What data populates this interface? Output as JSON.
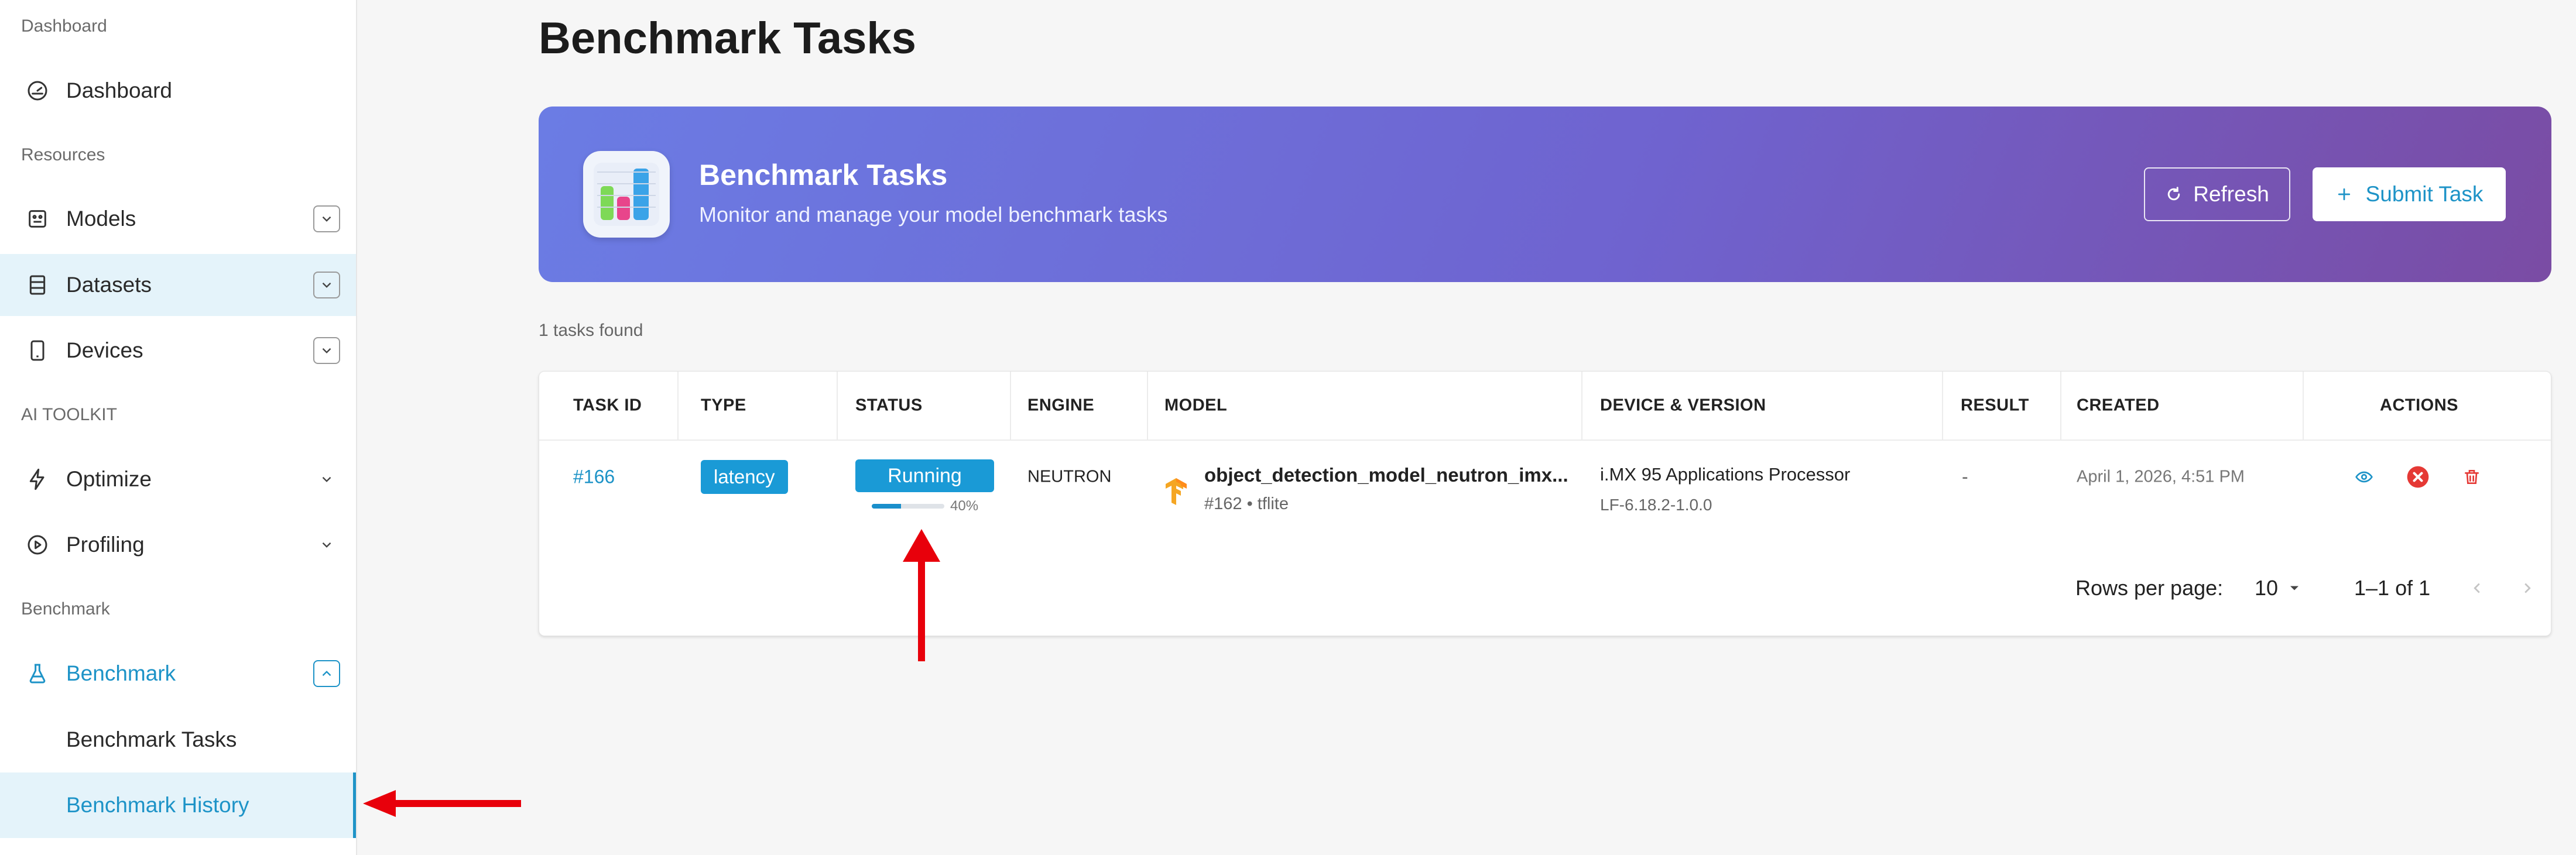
{
  "sidebar": {
    "section_dashboard": "Dashboard",
    "dashboard": "Dashboard",
    "section_resources": "Resources",
    "models": "Models",
    "datasets": "Datasets",
    "devices": "Devices",
    "section_ai_toolkit": "AI TOOLKIT",
    "optimize": "Optimize",
    "profiling": "Profiling",
    "section_benchmark": "Benchmark",
    "benchmark": "Benchmark",
    "benchmark_tasks": "Benchmark Tasks",
    "benchmark_history": "Benchmark History"
  },
  "page": {
    "title": "Benchmark Tasks"
  },
  "hero": {
    "title": "Benchmark Tasks",
    "subtitle": "Monitor and manage your model benchmark tasks",
    "refresh_label": "Refresh",
    "submit_label": "Submit Task"
  },
  "count_text": "1 tasks found",
  "table": {
    "headers": {
      "task_id": "TASK ID",
      "type": "TYPE",
      "status": "STATUS",
      "engine": "ENGINE",
      "model": "MODEL",
      "device": "DEVICE & VERSION",
      "result": "RESULT",
      "created": "CREATED",
      "actions": "ACTIONS"
    },
    "rows": [
      {
        "task_id": "#166",
        "type": "latency",
        "status": "Running",
        "progress": 0.4,
        "progress_text": "40%",
        "engine": "NEUTRON",
        "model_name": "object_detection_model_neutron_imx...",
        "model_sub": "#162 • tflite",
        "device_name": "i.MX 95 Applications Processor",
        "device_version": "LF-6.18.2-1.0.0",
        "result": "-",
        "created": "April 1, 2026, 4:51 PM"
      }
    ]
  },
  "pagination": {
    "rows_per_page_label": "Rows per page:",
    "rows_per_page_value": "10",
    "range_text": "1–1 of 1"
  },
  "colors": {
    "accent": "#1d93c7",
    "badge": "#1a9ad6",
    "hero_start": "#6b7ce4",
    "hero_end": "#7a4ca4",
    "annotation": "#e8000b"
  }
}
